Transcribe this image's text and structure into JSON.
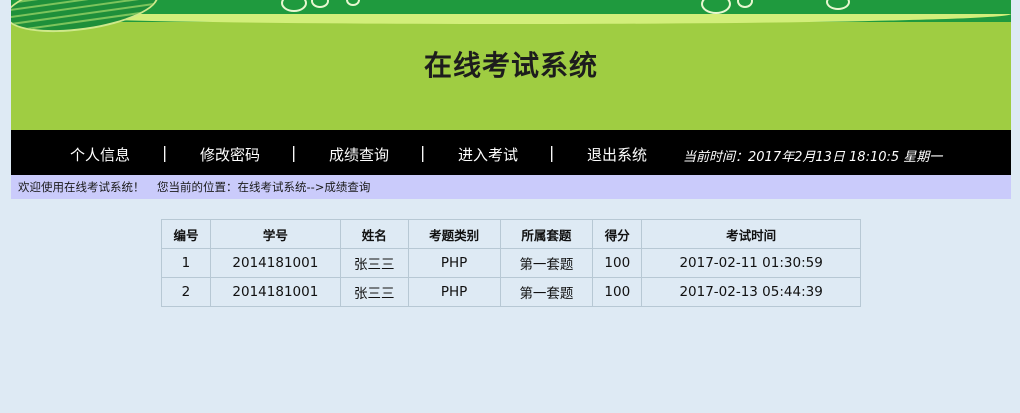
{
  "header": {
    "title": "在线考试系统"
  },
  "nav": {
    "items": [
      "个人信息",
      "修改密码",
      "成绩查询",
      "进入考试",
      "退出系统"
    ],
    "separator": "|",
    "time_label": "当前时间：2017年2月13日 18:10:5 星期一"
  },
  "location": {
    "welcome": "欢迎使用在线考试系统！",
    "path": "您当前的位置：在线考试系统-->成绩查询"
  },
  "grades_table": {
    "headers": [
      "编号",
      "学号",
      "姓名",
      "考题类别",
      "所属套题",
      "得分",
      "考试时间"
    ],
    "rows": [
      [
        "1",
        "2014181001",
        "张三三",
        "PHP",
        "第一套题",
        "100",
        "2017-02-11 01:30:59"
      ],
      [
        "2",
        "2014181001",
        "张三三",
        "PHP",
        "第一套题",
        "100",
        "2017-02-13 05:44:39"
      ]
    ]
  },
  "colors": {
    "banner": "#9fcd42",
    "banner_top": "#1f9a3e",
    "navbar": "#000000",
    "location_bar": "#cacbfb",
    "page_bg": "#deeaf4",
    "table_border": "#b7c8d4"
  }
}
